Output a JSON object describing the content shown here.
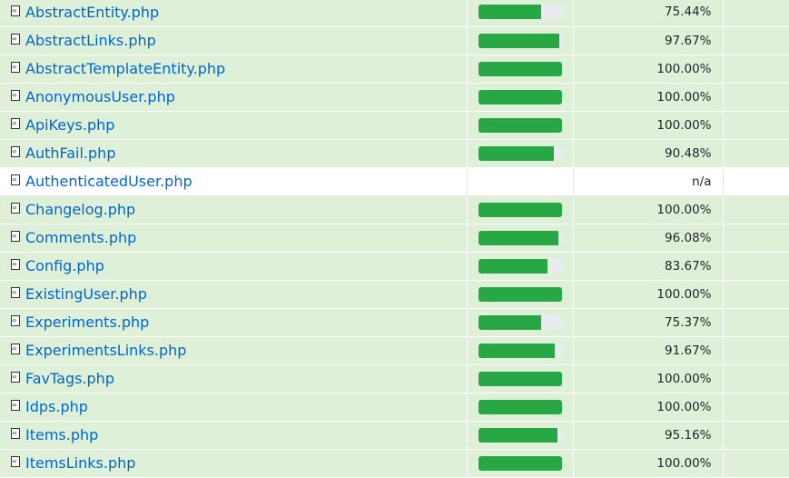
{
  "rows": [
    {
      "name": "AbstractEntity.php",
      "pct": "75.44%",
      "fill": 0.7544,
      "status": "success"
    },
    {
      "name": "AbstractLinks.php",
      "pct": "97.67%",
      "fill": 0.9767,
      "status": "success"
    },
    {
      "name": "AbstractTemplateEntity.php",
      "pct": "100.00%",
      "fill": 1.0,
      "status": "success"
    },
    {
      "name": "AnonymousUser.php",
      "pct": "100.00%",
      "fill": 1.0,
      "status": "success"
    },
    {
      "name": "ApiKeys.php",
      "pct": "100.00%",
      "fill": 1.0,
      "status": "success"
    },
    {
      "name": "AuthFail.php",
      "pct": "90.48%",
      "fill": 0.9048,
      "status": "success"
    },
    {
      "name": "AuthenticatedUser.php",
      "pct": "n/a",
      "fill": null,
      "status": "na"
    },
    {
      "name": "Changelog.php",
      "pct": "100.00%",
      "fill": 1.0,
      "status": "success"
    },
    {
      "name": "Comments.php",
      "pct": "96.08%",
      "fill": 0.9608,
      "status": "success"
    },
    {
      "name": "Config.php",
      "pct": "83.67%",
      "fill": 0.8367,
      "status": "success"
    },
    {
      "name": "ExistingUser.php",
      "pct": "100.00%",
      "fill": 1.0,
      "status": "success"
    },
    {
      "name": "Experiments.php",
      "pct": "75.37%",
      "fill": 0.7537,
      "status": "success"
    },
    {
      "name": "ExperimentsLinks.php",
      "pct": "91.67%",
      "fill": 0.9167,
      "status": "success"
    },
    {
      "name": "FavTags.php",
      "pct": "100.00%",
      "fill": 1.0,
      "status": "success"
    },
    {
      "name": "Idps.php",
      "pct": "100.00%",
      "fill": 1.0,
      "status": "success"
    },
    {
      "name": "Items.php",
      "pct": "95.16%",
      "fill": 0.9516,
      "status": "success"
    },
    {
      "name": "ItemsLinks.php",
      "pct": "100.00%",
      "fill": 1.0,
      "status": "success"
    }
  ]
}
